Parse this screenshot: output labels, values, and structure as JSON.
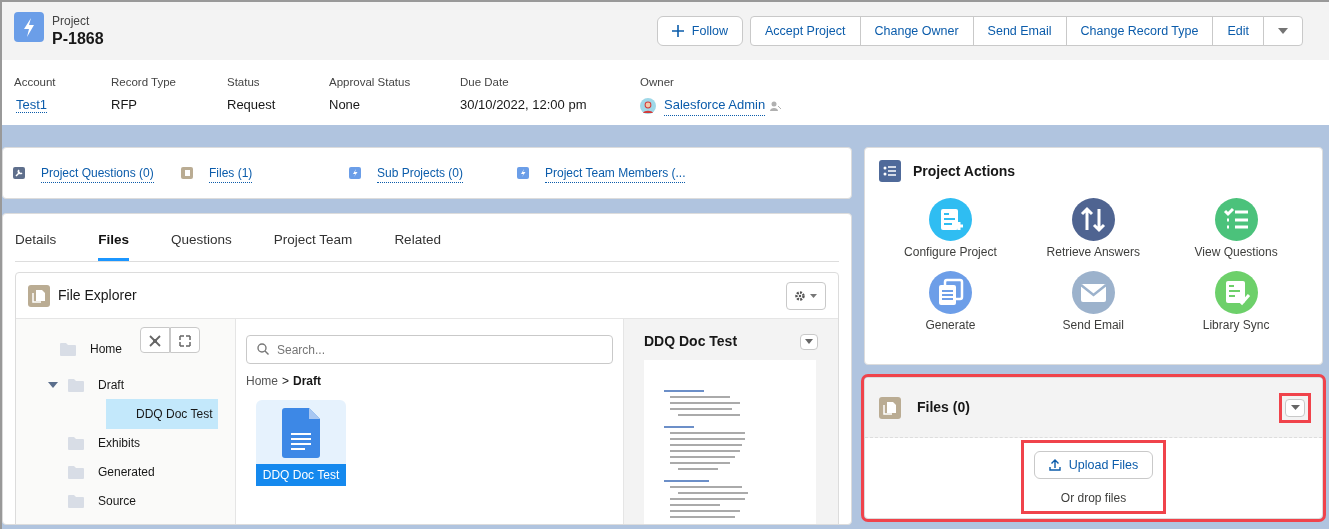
{
  "header": {
    "object_type": "Project",
    "record_name": "P-1868",
    "follow_button": "Follow",
    "actions": [
      "Accept Project",
      "Change Owner",
      "Send Email",
      "Change Record Type",
      "Edit"
    ]
  },
  "fields": [
    {
      "label": "Account",
      "value": "Test1",
      "kind": "link"
    },
    {
      "label": "Record Type",
      "value": "RFP",
      "kind": "text"
    },
    {
      "label": "Status",
      "value": "Request",
      "kind": "text"
    },
    {
      "label": "Approval Status",
      "value": "None",
      "kind": "text"
    },
    {
      "label": "Due Date",
      "value": "30/10/2022, 12:00 pm",
      "kind": "text"
    },
    {
      "label": "Owner",
      "value": "Salesforce Admin",
      "kind": "user"
    }
  ],
  "related_links": [
    {
      "label": "Project Questions (0)",
      "kind": "wrench",
      "color": "#5f6f8c"
    },
    {
      "label": "Files (1)",
      "kind": "file",
      "color": "#baac93"
    },
    {
      "label": "Sub Projects (0)",
      "kind": "bolt",
      "color": "#6b9ee8"
    },
    {
      "label": "Project Team Members (...",
      "kind": "bolt",
      "color": "#6b9ee8"
    }
  ],
  "tabs": [
    {
      "label": "Details",
      "selected": false
    },
    {
      "label": "Files",
      "selected": true
    },
    {
      "label": "Questions",
      "selected": false
    },
    {
      "label": "Project Team",
      "selected": false
    },
    {
      "label": "Related",
      "selected": false
    }
  ],
  "file_explorer": {
    "title": "File Explorer",
    "tree": [
      {
        "label": "Home",
        "selected": false,
        "children": [
          {
            "label": "Draft",
            "selected": false,
            "expanded": true,
            "children": [
              {
                "label": "DDQ Doc Test",
                "selected": true,
                "kind": "file"
              }
            ]
          },
          {
            "label": "Exhibits",
            "selected": false,
            "expanded": false
          },
          {
            "label": "Generated",
            "selected": false,
            "expanded": false
          },
          {
            "label": "Source",
            "selected": false,
            "expanded": false
          }
        ]
      }
    ],
    "search": {
      "placeholder": "Search..."
    },
    "breadcrumb": [
      "Home",
      "Draft"
    ],
    "breadcrumb_separator": ">",
    "files": [
      {
        "name": "DDQ Doc Test",
        "selected": true
      }
    ],
    "preview": {
      "title": "DDQ Doc Test"
    }
  },
  "project_actions": {
    "title": "Project Actions",
    "items": [
      {
        "label": "Configure Project",
        "kind": "configure",
        "color": "#2fbdf2"
      },
      {
        "label": "Retrieve Answers",
        "kind": "retrieve",
        "color": "#4f6491"
      },
      {
        "label": "View Questions",
        "kind": "checklist",
        "color": "#4bc27b"
      },
      {
        "label": "Generate",
        "kind": "copies",
        "color": "#6d9ee8"
      },
      {
        "label": "Send Email",
        "kind": "email",
        "color": "#9cb2cc"
      },
      {
        "label": "Library Sync",
        "kind": "sync",
        "color": "#6dd06a"
      }
    ]
  },
  "files_card": {
    "title": "Files (0)",
    "upload_button": "Upload Files",
    "drop_text": "Or drop files",
    "highlighted": true,
    "menu_highlighted": true,
    "upload_highlighted": true
  }
}
